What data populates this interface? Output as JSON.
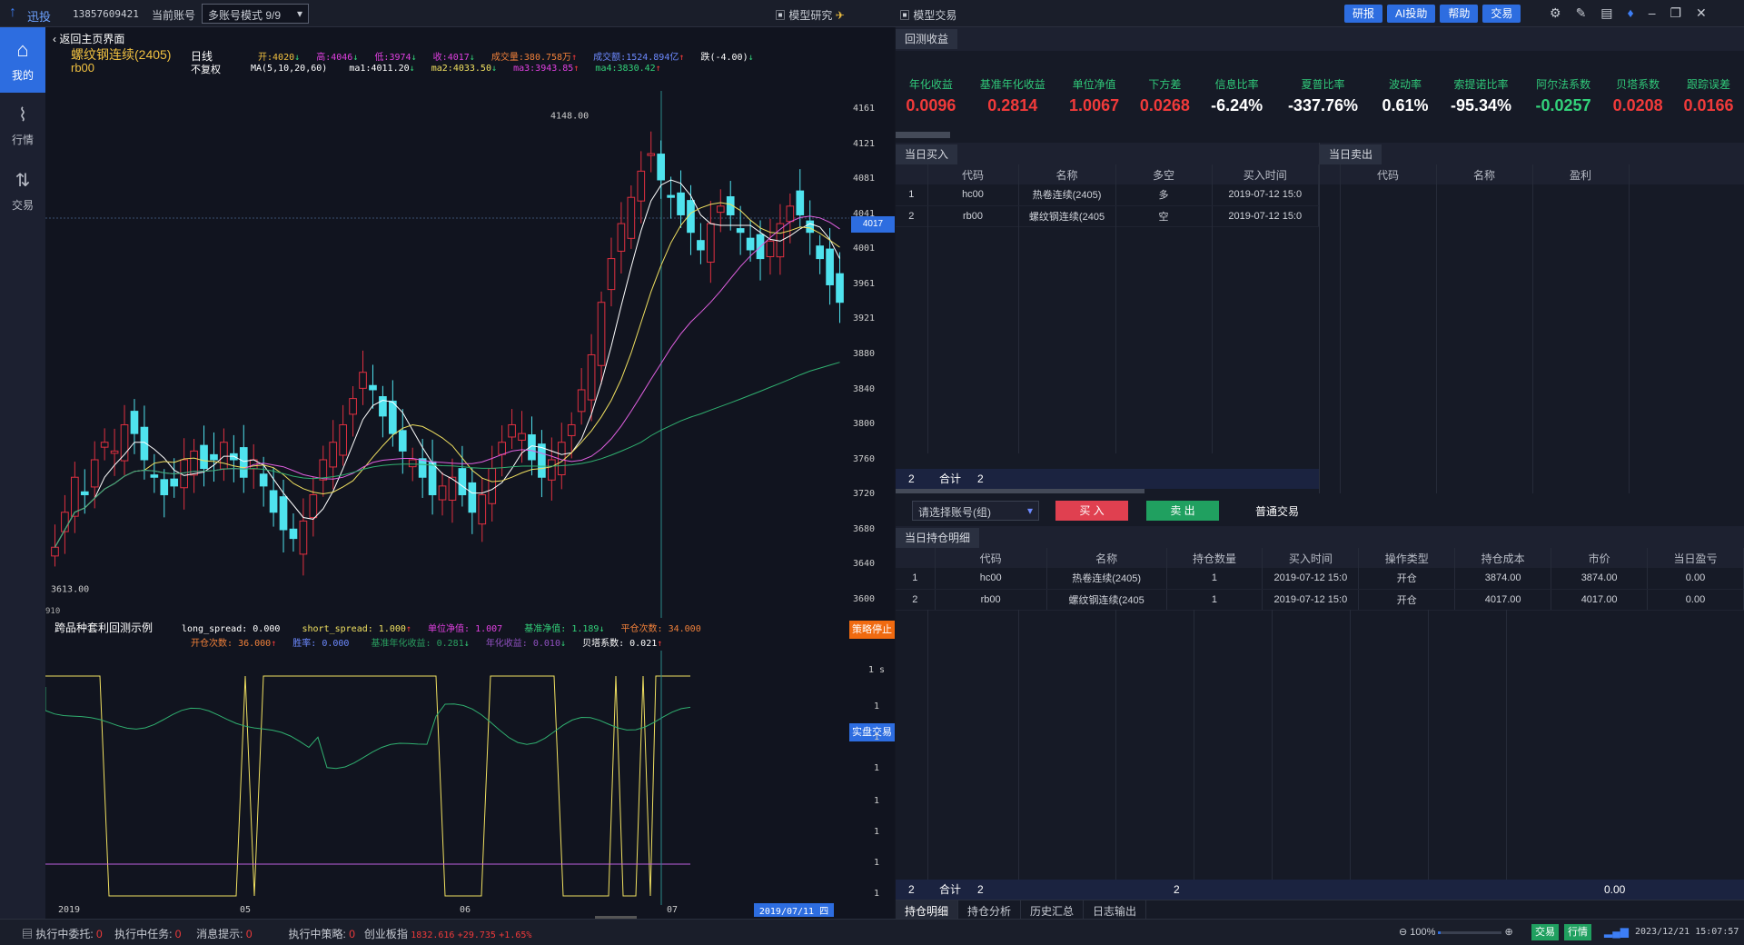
{
  "topbar": {
    "brand": "迅投",
    "account_id": "13857609421",
    "account_label": "当前账号",
    "account_mode": "多账号模式 9/9",
    "model_research": "模型研究",
    "model_trade": "模型交易",
    "buttons": [
      "研报",
      "AI投助",
      "帮助",
      "交易"
    ]
  },
  "sidebar": {
    "items": [
      {
        "label": "我的",
        "icon": "home-icon"
      },
      {
        "label": "行情",
        "icon": "chart-icon"
      },
      {
        "label": "交易",
        "icon": "swap-icon"
      }
    ]
  },
  "chart": {
    "back_label": "返回主页界面",
    "symbol": "螺纹钢连续(2405)",
    "code": "rb00",
    "period": "日线",
    "adjust": "不复权",
    "ohlc": [
      {
        "k": "开:",
        "v": "4020"
      },
      {
        "k": "高:",
        "v": "4046"
      },
      {
        "k": "低:",
        "v": "3974"
      },
      {
        "k": "收:",
        "v": "4017"
      },
      {
        "k": "成交量:",
        "v": "380.758万"
      },
      {
        "k": "成交额:",
        "v": "1524.894亿"
      }
    ],
    "change": "跌(-4.00)",
    "ma_label": "MA(5,10,20,60)",
    "mas": [
      {
        "k": "ma1:",
        "v": "4011.20"
      },
      {
        "k": "ma2:",
        "v": "4033.50"
      },
      {
        "k": "ma3:",
        "v": "3943.85"
      },
      {
        "k": "ma4:",
        "v": "3830.42"
      }
    ],
    "high_mark": "4148.00",
    "low_mark": "3613.00",
    "price_tag": "4017",
    "y_ticks": [
      "4161",
      "4121",
      "4081",
      "4041",
      "4001",
      "3961",
      "3921",
      "3880",
      "3840",
      "3800",
      "3760",
      "3720",
      "3680",
      "3640",
      "3600"
    ],
    "left_cut": "910"
  },
  "indicator": {
    "title": "跨品种套利回测示例",
    "row1": [
      {
        "k": "long_spread:",
        "v": "0.000"
      },
      {
        "k": "short_spread:",
        "v": "1.000"
      },
      {
        "k": "单位净值:",
        "v": "1.007"
      },
      {
        "k": "基准净值:",
        "v": "1.189"
      },
      {
        "k": "平仓次数:",
        "v": "34.000"
      }
    ],
    "row2": [
      {
        "k": "开仓次数:",
        "v": "36.000"
      },
      {
        "k": "胜率:",
        "v": "0.000"
      },
      {
        "k": "基准年化收益:",
        "v": "0.281"
      },
      {
        "k": "年化收益:",
        "v": "0.010"
      },
      {
        "k": "贝塔系数:",
        "v": "0.021"
      }
    ],
    "stop_btn": "策略停止",
    "real_btn": "实盘交易",
    "ticks": [
      "1 s",
      "1",
      "1",
      "1",
      "1",
      "1",
      "1",
      "1"
    ]
  },
  "xaxis": {
    "labels": [
      "2019",
      "05",
      "06",
      "07"
    ],
    "cursor_date": "2019/07/11 四"
  },
  "chart_data": {
    "type": "candlestick",
    "y_range": [
      3600,
      4161
    ],
    "closes": [
      3660,
      3700,
      3740,
      3720,
      3760,
      3780,
      3770,
      3800,
      3790,
      3760,
      3740,
      3720,
      3730,
      3760,
      3770,
      3750,
      3760,
      3780,
      3760,
      3740,
      3760,
      3730,
      3700,
      3680,
      3670,
      3690,
      3720,
      3760,
      3780,
      3800,
      3830,
      3860,
      3840,
      3810,
      3790,
      3770,
      3760,
      3740,
      3720,
      3730,
      3740,
      3720,
      3700,
      3720,
      3750,
      3780,
      3800,
      3790,
      3760,
      3740,
      3760,
      3780,
      3800,
      3840,
      3880,
      3940,
      3990,
      4030,
      4060,
      4090,
      4110,
      4080,
      4060,
      4040,
      4020,
      4000,
      4030,
      4050,
      4040,
      4020,
      4000,
      3990,
      4010,
      4030,
      4050,
      4040,
      4020,
      3990,
      3960,
      3940
    ]
  },
  "backtest": {
    "tab": "回测收益",
    "metrics": [
      {
        "label": "年化收益",
        "value": "0.0096",
        "color": "red"
      },
      {
        "label": "基准年化收益",
        "value": "0.2814",
        "color": "red"
      },
      {
        "label": "单位净值",
        "value": "1.0067",
        "color": "red"
      },
      {
        "label": "下方差",
        "value": "0.0268",
        "color": "red"
      },
      {
        "label": "信息比率",
        "value": "-6.24%",
        "color": "white"
      },
      {
        "label": "夏普比率",
        "value": "-337.76%",
        "color": "white"
      },
      {
        "label": "波动率",
        "value": "0.61%",
        "color": "white"
      },
      {
        "label": "索提诺比率",
        "value": "-95.34%",
        "color": "white"
      },
      {
        "label": "阿尔法系数",
        "value": "-0.0257",
        "color": "green"
      },
      {
        "label": "贝塔系数",
        "value": "0.0208",
        "color": "red"
      },
      {
        "label": "跟踪误差",
        "value": "0.0166",
        "color": "red"
      }
    ]
  },
  "buy": {
    "tab": "当日买入",
    "headers": [
      "",
      "代码",
      "名称",
      "多空",
      "买入时间"
    ],
    "rows": [
      [
        "1",
        "hc00",
        "热卷连续(2405)",
        "多",
        "2019-07-12 15:0"
      ],
      [
        "2",
        "rb00",
        "螺纹钢连续(2405",
        "空",
        "2019-07-12 15:0"
      ]
    ],
    "total_label": "合计",
    "total_count": "2",
    "total_index": "2"
  },
  "sell": {
    "tab": "当日卖出",
    "headers": [
      "代码",
      "名称",
      "盈利"
    ]
  },
  "order": {
    "account_select": "请选择账号(组)",
    "buy_btn": "买 入",
    "sell_btn": "卖 出",
    "normal_trade": "普通交易"
  },
  "positions": {
    "tab": "当日持仓明细",
    "headers": [
      "",
      "代码",
      "名称",
      "持仓数量",
      "买入时间",
      "操作类型",
      "持仓成本",
      "市价",
      "当日盈亏"
    ],
    "rows": [
      [
        "1",
        "hc00",
        "热卷连续(2405)",
        "1",
        "2019-07-12 15:0",
        "开仓",
        "3874.00",
        "3874.00",
        "0.00"
      ],
      [
        "2",
        "rb00",
        "螺纹钢连续(2405",
        "1",
        "2019-07-12 15:0",
        "开仓",
        "4017.00",
        "4017.00",
        "0.00"
      ]
    ],
    "total_index": "2",
    "total_label": "合计",
    "total_count": "2",
    "total_qty": "2",
    "total_pnl": "0.00"
  },
  "bottom_tabs": [
    "持仓明细",
    "持仓分析",
    "历史汇总",
    "日志输出"
  ],
  "status": {
    "items": [
      {
        "k": "执行中委托:",
        "v": "0"
      },
      {
        "k": "执行中任务:",
        "v": "0"
      },
      {
        "k": "消息提示:",
        "v": "0"
      },
      {
        "k": "执行中策略:",
        "v": "0"
      }
    ],
    "index_name": "创业板指",
    "index_value": "1832.616",
    "index_change": "+29.735",
    "index_pct": "+1.65%",
    "zoom": "100%",
    "trade_btn": "交易",
    "quote_btn": "行情",
    "datetime": "2023/12/21 15:07:57"
  }
}
